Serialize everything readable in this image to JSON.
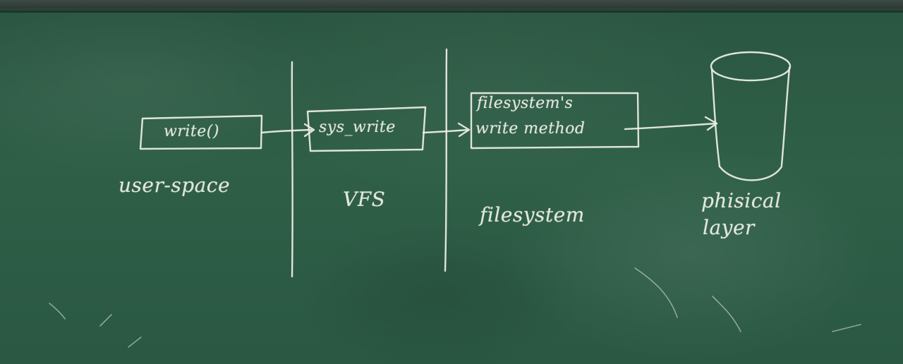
{
  "boxes": {
    "user_space_call": "write()",
    "vfs_call": "sys_write",
    "fs_method_line1": "filesystem's",
    "fs_method_line2": "write method"
  },
  "labels": {
    "user_space": "user-space",
    "vfs": "VFS",
    "filesystem": "filesystem",
    "physical_line1": "phisical",
    "physical_line2": "layer"
  },
  "icons": {
    "storage": "cylinder-disk-icon"
  },
  "colors": {
    "board": "#2c5a43",
    "chalk": "#eef0e6"
  }
}
